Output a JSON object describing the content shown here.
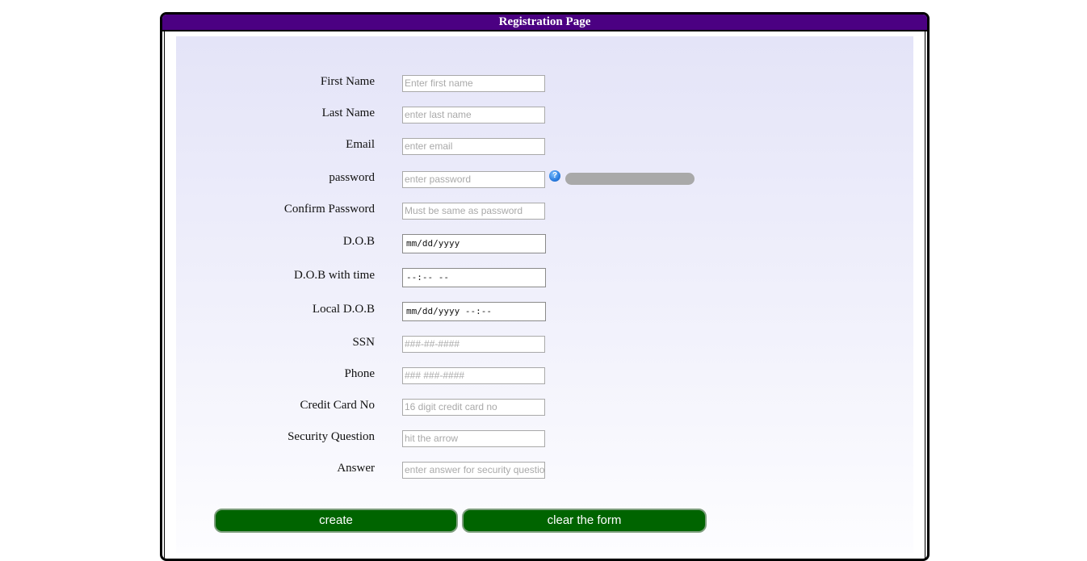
{
  "page": {
    "title": "Registration Page"
  },
  "colors": {
    "titlebar": "#4b0082",
    "button": "#006400",
    "help_icon": "#2a7de0"
  },
  "form": {
    "first_name": {
      "label": "First Name",
      "placeholder": "Enter first name",
      "value": ""
    },
    "last_name": {
      "label": "Last Name",
      "placeholder": "enter last name",
      "value": ""
    },
    "email": {
      "label": "Email",
      "placeholder": "enter email",
      "value": ""
    },
    "password": {
      "label": "password",
      "placeholder": "enter password",
      "value": "",
      "help_icon": "question-icon",
      "help_glyph": "?",
      "strength": 0
    },
    "confirm_password": {
      "label": "Confirm Password",
      "placeholder": "Must be same as  password",
      "value": ""
    },
    "dob": {
      "label": "D.O.B",
      "display": "mm/dd/yyyy"
    },
    "dob_time": {
      "label": "D.O.B with time",
      "display": "--:-- --"
    },
    "local_dob": {
      "label": "Local D.O.B",
      "display": "mm/dd/yyyy --:--"
    },
    "ssn": {
      "label": "SSN",
      "placeholder": "###-##-####",
      "value": ""
    },
    "phone": {
      "label": "Phone",
      "placeholder": "### ###-####",
      "value": ""
    },
    "credit_card": {
      "label": "Credit Card No",
      "placeholder": "16 digit credit card no",
      "value": ""
    },
    "security_question": {
      "label": "Security Question",
      "placeholder": "hit the arrow",
      "value": ""
    },
    "answer": {
      "label": "Answer",
      "placeholder": "enter answer for security question",
      "value": ""
    }
  },
  "buttons": {
    "create": "create",
    "clear": "clear the form"
  }
}
